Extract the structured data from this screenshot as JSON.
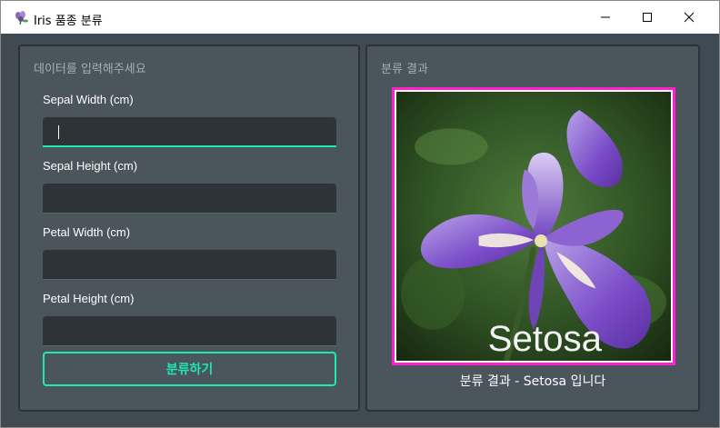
{
  "window": {
    "title": "Iris 품종 분류"
  },
  "input_panel": {
    "title": "데이터를 입력해주세요",
    "fields": [
      {
        "label": "Sepal Width (cm)",
        "value": "",
        "focused": true
      },
      {
        "label": "Sepal Height (cm)",
        "value": ""
      },
      {
        "label": "Petal Width (cm)",
        "value": ""
      },
      {
        "label": "Petal Height (cm)",
        "value": ""
      }
    ],
    "classify_button": "분류하기"
  },
  "result_panel": {
    "title": "분류 결과",
    "image_label": "Setosa",
    "caption": "분류 결과 - Setosa 입니다"
  },
  "colors": {
    "accent": "#1de9b6",
    "image_border": "#ff1fd0",
    "background": "#3f4a52"
  }
}
